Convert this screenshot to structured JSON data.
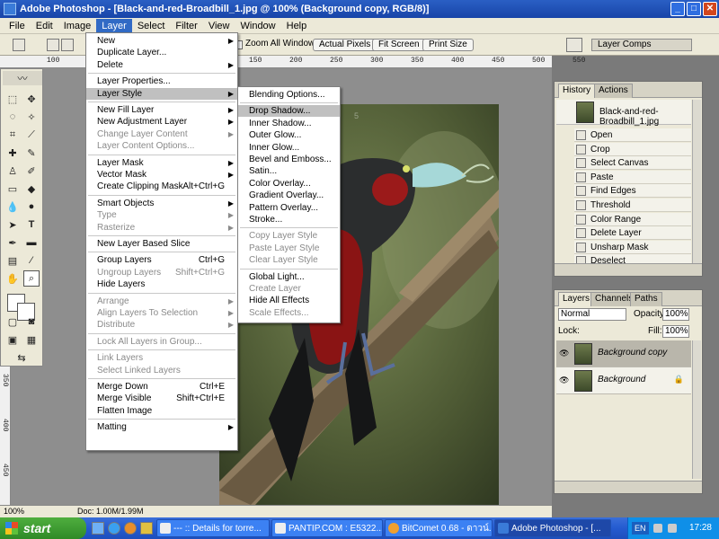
{
  "window": {
    "title": "Adobe Photoshop - [Black-and-red-Broadbill_1.jpg @ 100% (Background copy, RGB/8)]",
    "min": "_",
    "max": "□",
    "close": "✕"
  },
  "menubar": [
    "File",
    "Edit",
    "Image",
    "Layer",
    "Select",
    "Filter",
    "View",
    "Window",
    "Help"
  ],
  "options": {
    "zoom_all": "Zoom All Windows",
    "actual": "Actual Pixels",
    "fit": "Fit Screen",
    "print": "Print Size",
    "layer_comps": "Layer Comps"
  },
  "layer_menu": [
    {
      "label": "New",
      "arrow": true
    },
    {
      "label": "Duplicate Layer..."
    },
    {
      "label": "Delete",
      "arrow": true
    },
    {
      "sep": true
    },
    {
      "label": "Layer Properties..."
    },
    {
      "label": "Layer Style",
      "arrow": true,
      "state": "highlighted"
    },
    {
      "sep": true
    },
    {
      "label": "New Fill Layer",
      "arrow": true
    },
    {
      "label": "New Adjustment Layer",
      "arrow": true
    },
    {
      "label": "Change Layer Content",
      "arrow": true,
      "disabled": true
    },
    {
      "label": "Layer Content Options...",
      "disabled": true
    },
    {
      "sep": true
    },
    {
      "label": "Layer Mask",
      "arrow": true
    },
    {
      "label": "Vector Mask",
      "arrow": true
    },
    {
      "label": "Create Clipping Mask",
      "shortcut": "Alt+Ctrl+G"
    },
    {
      "sep": true
    },
    {
      "label": "Smart Objects",
      "arrow": true
    },
    {
      "label": "Type",
      "arrow": true,
      "disabled": true
    },
    {
      "label": "Rasterize",
      "arrow": true,
      "disabled": true
    },
    {
      "sep": true
    },
    {
      "label": "New Layer Based Slice"
    },
    {
      "sep": true
    },
    {
      "label": "Group Layers",
      "shortcut": "Ctrl+G"
    },
    {
      "label": "Ungroup Layers",
      "shortcut": "Shift+Ctrl+G",
      "disabled": true
    },
    {
      "label": "Hide Layers"
    },
    {
      "sep": true
    },
    {
      "label": "Arrange",
      "arrow": true,
      "disabled": true
    },
    {
      "label": "Align Layers To Selection",
      "arrow": true,
      "disabled": true
    },
    {
      "label": "Distribute",
      "arrow": true,
      "disabled": true
    },
    {
      "sep": true
    },
    {
      "label": "Lock All Layers in Group...",
      "disabled": true
    },
    {
      "sep": true
    },
    {
      "label": "Link Layers",
      "disabled": true
    },
    {
      "label": "Select Linked Layers",
      "disabled": true
    },
    {
      "sep": true
    },
    {
      "label": "Merge Down",
      "shortcut": "Ctrl+E"
    },
    {
      "label": "Merge Visible",
      "shortcut": "Shift+Ctrl+E"
    },
    {
      "label": "Flatten Image"
    },
    {
      "sep": true
    },
    {
      "label": "Matting",
      "arrow": true
    }
  ],
  "style_menu": [
    {
      "label": "Blending Options..."
    },
    {
      "sep": true
    },
    {
      "label": "Drop Shadow...",
      "state": "selected"
    },
    {
      "label": "Inner Shadow..."
    },
    {
      "label": "Outer Glow..."
    },
    {
      "label": "Inner Glow..."
    },
    {
      "label": "Bevel and Emboss..."
    },
    {
      "label": "Satin..."
    },
    {
      "label": "Color Overlay..."
    },
    {
      "label": "Gradient Overlay..."
    },
    {
      "label": "Pattern Overlay..."
    },
    {
      "label": "Stroke..."
    },
    {
      "sep": true
    },
    {
      "label": "Copy Layer Style",
      "disabled": true
    },
    {
      "label": "Paste Layer Style",
      "disabled": true
    },
    {
      "label": "Clear Layer Style",
      "disabled": true
    },
    {
      "sep": true
    },
    {
      "label": "Global Light..."
    },
    {
      "label": "Create Layer",
      "disabled": true
    },
    {
      "label": "Hide All Effects"
    },
    {
      "label": "Scale Effects...",
      "disabled": true
    }
  ],
  "history": {
    "tabs": [
      "History",
      "Actions"
    ],
    "snapshot": "Black-and-red-Broadbill_1.jpg",
    "items": [
      "Open",
      "Crop",
      "Select Canvas",
      "Paste",
      "Find Edges",
      "Threshold",
      "Color Range",
      "Delete Layer",
      "Unsharp Mask",
      "Deselect"
    ]
  },
  "layers": {
    "tabs": [
      "Layers",
      "Channels",
      "Paths"
    ],
    "blend": "Normal",
    "opacity_label": "Opacity:",
    "opacity": "100%",
    "lock_label": "Lock:",
    "fill_label": "Fill:",
    "fill": "100%",
    "items": [
      {
        "name": "Background copy",
        "selected": true
      },
      {
        "name": "Background",
        "locked": true
      }
    ]
  },
  "status": {
    "zoom": "100%",
    "doc": "Doc: 1.00M/1.99M"
  },
  "taskbar": {
    "start": "start",
    "tasks": [
      "--- :: Details for torre...",
      "PANTIP.COM : E5322...",
      "BitComet 0.68 - ดาวน์...",
      "Adobe Photoshop - [..."
    ],
    "lang": "EN",
    "clock": "17:28"
  },
  "ruler_h": [
    "100",
    "50",
    "0",
    "50",
    "100",
    "150",
    "200",
    "250",
    "300",
    "350",
    "400",
    "450",
    "500",
    "550"
  ],
  "ruler_v": [
    "50",
    "100",
    "150",
    "200",
    "250",
    "300",
    "350",
    "400",
    "450"
  ],
  "watermark": "5"
}
